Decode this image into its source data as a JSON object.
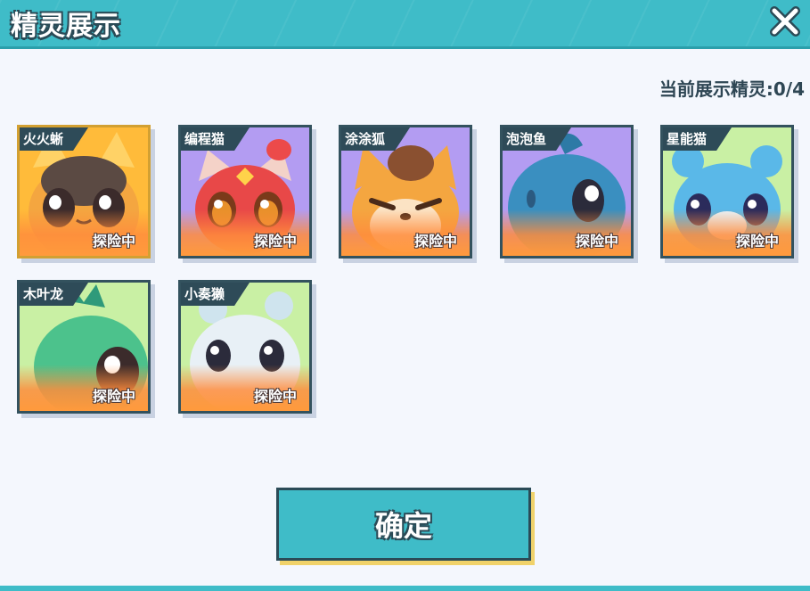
{
  "header": {
    "title": "精灵展示",
    "close_icon": "close-icon"
  },
  "display_count": {
    "label": "当前展示精灵:0/4"
  },
  "sprites": [
    {
      "name": "火火蜥",
      "status": "探险中",
      "bg": "#ffbb3a",
      "selected": true
    },
    {
      "name": "编程猫",
      "status": "探险中",
      "bg": "#b39cf2",
      "selected": false
    },
    {
      "name": "涂涂狐",
      "status": "探险中",
      "bg": "#b39cf2",
      "selected": false
    },
    {
      "name": "泡泡鱼",
      "status": "探险中",
      "bg": "#b39cf2",
      "selected": false
    },
    {
      "name": "星能猫",
      "status": "探险中",
      "bg": "#c9f0a4",
      "selected": false
    },
    {
      "name": "木叶龙",
      "status": "探险中",
      "bg": "#c9f0a4",
      "selected": false
    },
    {
      "name": "小奏獭",
      "status": "探险中",
      "bg": "#c9f0a4",
      "selected": false
    }
  ],
  "confirm_button": {
    "label": "确定"
  }
}
